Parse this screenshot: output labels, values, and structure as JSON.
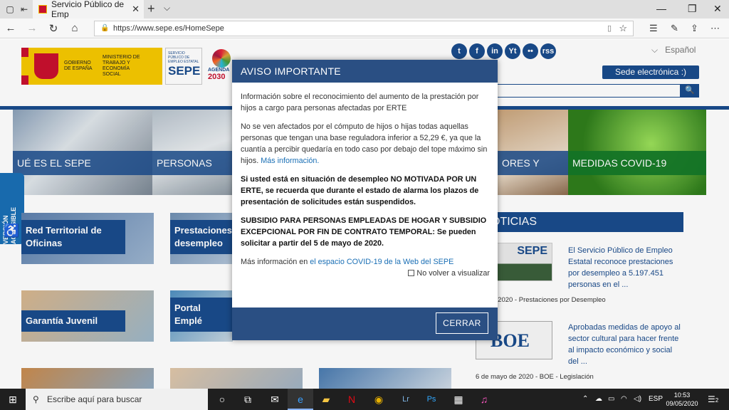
{
  "browser": {
    "tab_title": "Servicio Público de Emp",
    "url": "https://www.sepe.es/HomeSepe"
  },
  "header": {
    "gov_line1": "GOBIERNO DE ESPAÑA",
    "gov_line2": "MINISTERIO DE TRABAJO Y ECONOMÍA SOCIAL",
    "sepe_small": "SERVICIO PÚBLICO DE EMPLEO ESTATAL",
    "sepe_big": "SEPE",
    "agenda_label": "AGENDA",
    "agenda_year": "2030",
    "language": "Español",
    "sede_button": "Sede electrónica  :)",
    "social": [
      "t",
      "f",
      "in",
      "Yt",
      "••",
      "rss"
    ]
  },
  "hero": {
    "que_es": "UÉ ES EL SEPE",
    "personas": "PERSONAS",
    "empresas": "ORES Y",
    "covid": "MEDIDAS COVID-19"
  },
  "accesible": "VERSIÓN ACCESIBLE",
  "cards": {
    "red_territorial": "Red Territorial de Oficinas",
    "prestaciones": "Prestaciones desempleo",
    "garantia": "Garantía Juvenil",
    "portal": "Portal Emplé"
  },
  "news": {
    "heading": "OTICIAS",
    "item1_text": "El Servicio Público de Empleo Estatal reconoce prestaciones por desempleo a 5.197.451 personas en el ...",
    "item1_date": "ayo de 2020 - Prestaciones por Desempleo",
    "item1_img_label": "SEPE",
    "item2_text": "Aprobadas medidas de apoyo al sector cultural para hacer frente al impacto económico y social del ...",
    "item2_date": "6 de mayo de 2020 - BOE - Legislación",
    "item2_img_label": "BOE"
  },
  "modal": {
    "title": "AVISO IMPORTANTE",
    "p1": "Información sobre el reconocimiento del aumento de la prestación por hijos a cargo para personas afectadas por ERTE",
    "p2": "No se ven afectados por el cómputo de hijos o hijas todas aquellas personas que tengan una base reguladora inferior a 52,29 €, ya que la cuantía a percibir quedaría en todo caso por debajo del tope máximo sin hijos.",
    "p2_link": "Más información.",
    "p3": "Si usted está en  situación de desempleo NO MOTIVADA POR UN  ERTE, se recuerda que durante el estado de alarma los plazos de presentación de solicitudes están suspendidos.",
    "p4": "SUBSIDIO PARA PERSONAS EMPLEADAS DE HOGAR Y SUBSIDIO EXCEPCIONAL POR FIN DE CONTRATO TEMPORAL: Se pueden solicitar a partir del 5 de mayo de 2020.",
    "p5_prefix": "Más información en",
    "p5_link": "el espacio COVID-19 de la Web del SEPE",
    "no_volver": "No volver a visualizar",
    "close_button": "CERRAR"
  },
  "taskbar": {
    "search_placeholder": "Escribe aquí para buscar",
    "lang": "ESP",
    "time": "10:53",
    "date": "09/05/2020",
    "notifications": "2"
  },
  "colors": {
    "brand_blue": "#1a4b8c",
    "modal_header": "#2a4f83",
    "covid_green": "#147828"
  }
}
